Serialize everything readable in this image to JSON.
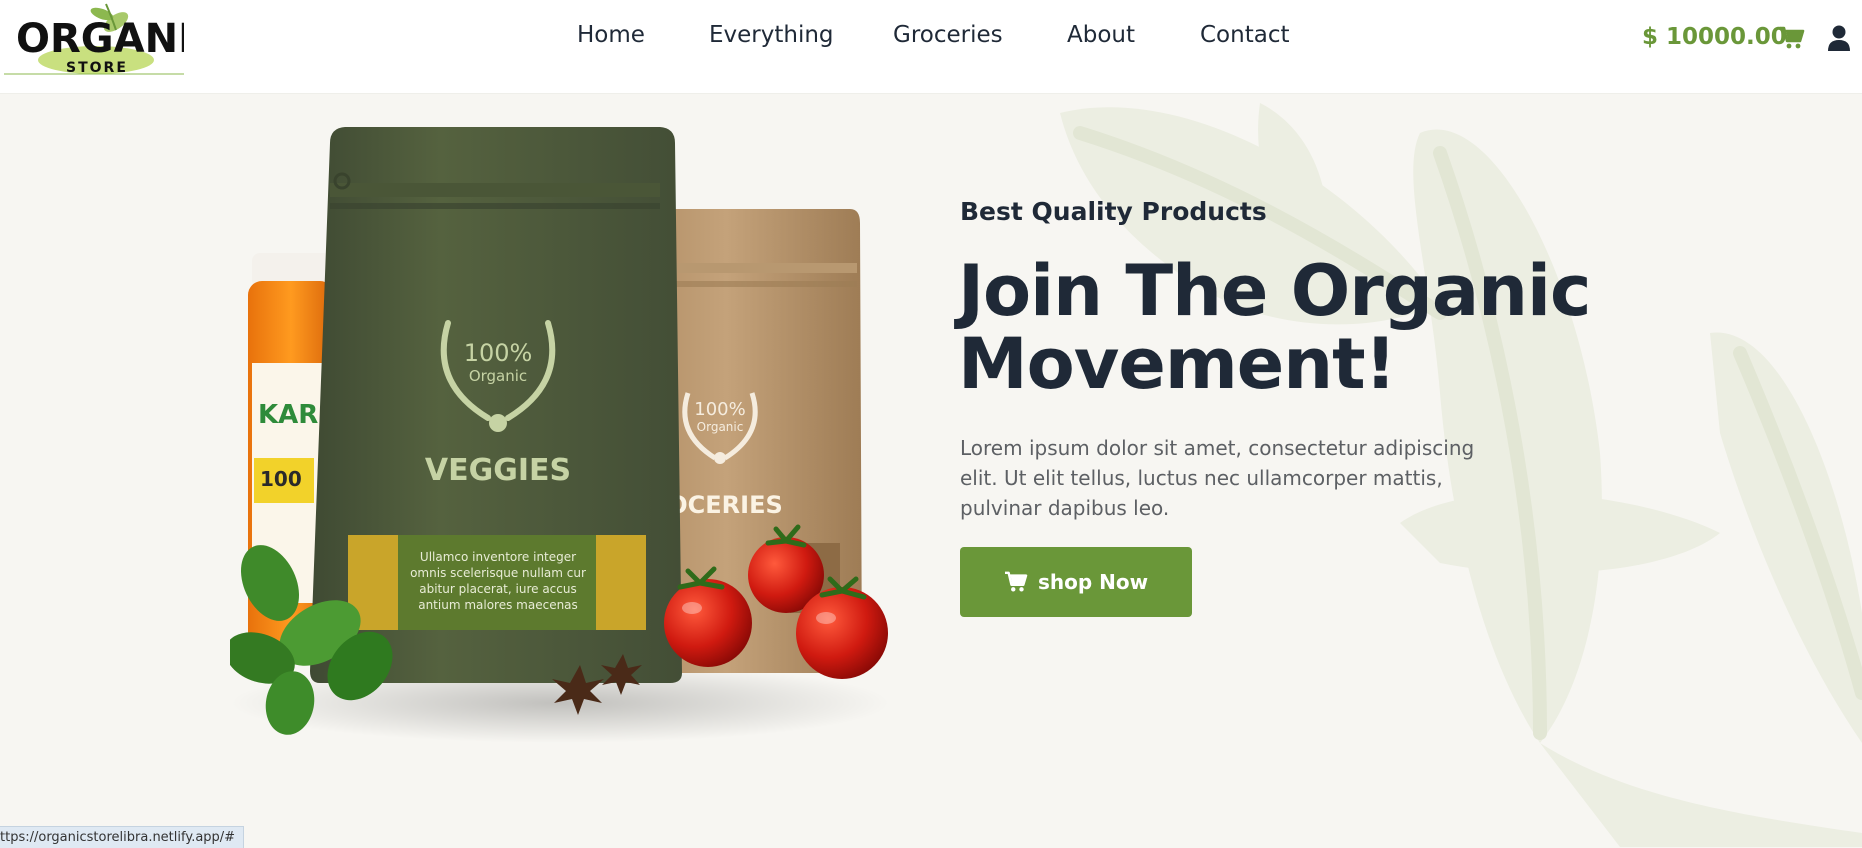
{
  "header": {
    "logo": {
      "word_main": "ORGANIC",
      "word_sub": "STORE"
    },
    "nav": [
      {
        "label": "Home"
      },
      {
        "label": "Everything"
      },
      {
        "label": "Groceries"
      },
      {
        "label": "About"
      },
      {
        "label": "Contact"
      }
    ],
    "cart_total": "$  10000.00",
    "icons": {
      "cart": "shopping-cart-icon",
      "account": "user-icon"
    }
  },
  "hero": {
    "subtitle": "Best Quality Products",
    "title": "Join The Organic Movement!",
    "description": "Lorem ipsum dolor sit amet, consectetur adipiscing elit. Ut elit tellus, luctus nec ullamcorper mattis, pulvinar dapibus leo.",
    "button_label": "shop Now",
    "product_image": {
      "bag_front_badge_pct": "100%",
      "bag_front_badge_word": "Organic",
      "bag_front_name": "VEGGIES",
      "bag_front_blurb": [
        "Ullamco inventore integer",
        "omnis scelerisque nullam cur",
        "abitur placerat, iure accus",
        "antium malores maecenas"
      ],
      "bag_back_badge_pct": "100%",
      "bag_back_badge_word": "Organic",
      "bag_back_name": "OCERIES",
      "jar_label": "KAR"
    }
  },
  "status_bar": {
    "url": "ttps://organicstorelibra.netlify.app/#"
  },
  "colors": {
    "accent": "#6a9739",
    "heading": "#1f2937",
    "background": "#f7f6f2"
  }
}
